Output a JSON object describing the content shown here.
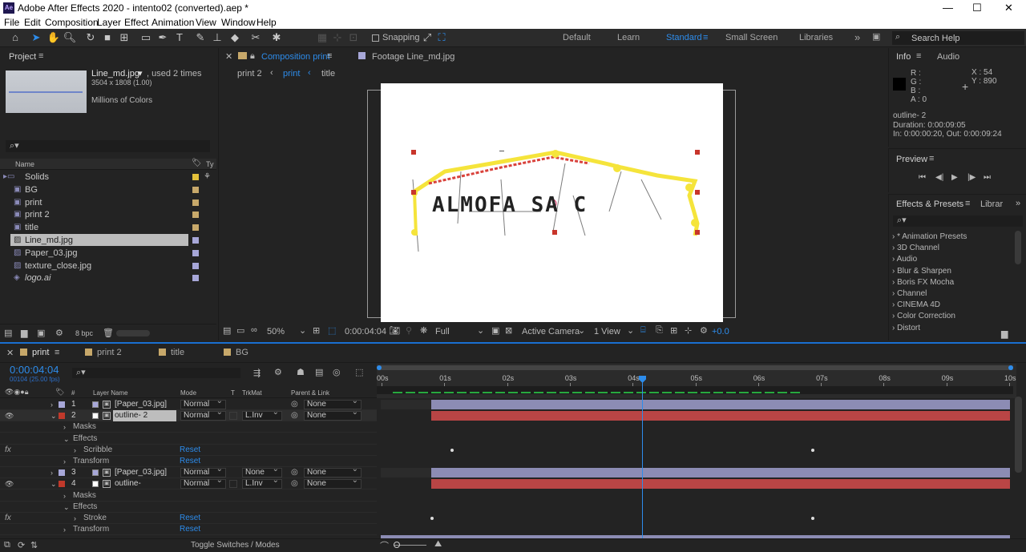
{
  "app": {
    "title": "Adobe After Effects 2020 - intento02 (converted).aep *",
    "icon": "Ae"
  },
  "window_controls": {
    "minimize": "—",
    "maximize": "☐",
    "close": "✕"
  },
  "menu": [
    "File",
    "Edit",
    "Composition",
    "Layer",
    "Effect",
    "Animation",
    "View",
    "Window",
    "Help"
  ],
  "toolbar": {
    "snapping": "Snapping"
  },
  "workspaces": {
    "items": [
      "Default",
      "Learn",
      "Standard",
      "Small Screen",
      "Libraries"
    ],
    "active": "Standard",
    "more": "»"
  },
  "search_help": "Search Help",
  "project": {
    "title": "Project",
    "item_name": "Line_md.jpg",
    "used": ", used 2 times",
    "dims": "3504 x 1808 (1.00)",
    "colors": "Millions of Colors",
    "col_name": "Name",
    "col_type": "Ty",
    "items": [
      {
        "name": "Solids",
        "color": "#e3c13a",
        "kind": "folder"
      },
      {
        "name": "BG",
        "color": "#c7a86a",
        "kind": "comp"
      },
      {
        "name": "print",
        "color": "#c7a86a",
        "kind": "comp"
      },
      {
        "name": "print 2",
        "color": "#c7a86a",
        "kind": "comp"
      },
      {
        "name": "title",
        "color": "#c7a86a",
        "kind": "comp"
      },
      {
        "name": "Line_md.jpg",
        "color": "#a7a7d8",
        "kind": "image",
        "selected": true
      },
      {
        "name": "Paper_03.jpg",
        "color": "#a7a7d8",
        "kind": "image"
      },
      {
        "name": "texture_close.jpg",
        "color": "#a7a7d8",
        "kind": "image"
      },
      {
        "name": "logo.ai",
        "color": "#a7a7d8",
        "kind": "ai"
      }
    ],
    "bpc": "8 bpc"
  },
  "comp_panel": {
    "tab_comp": "Composition print",
    "tab_footage": "Footage Line_md.jpg",
    "breadcrumbs": [
      "print 2",
      "print",
      "title"
    ],
    "active_crumb": "print",
    "canvas_text": "ALMOFA SA C"
  },
  "viewer_bar": {
    "zoom": "50%",
    "time": "0:00:04:04",
    "resolution": "Full",
    "camera": "Active Camera",
    "views": "1 View",
    "exposure": "+0.0"
  },
  "info": {
    "tab": "Info",
    "tab2": "Audio",
    "r": "R :",
    "g": "G :",
    "b": "B :",
    "a": "A : 0",
    "x": "X : 54",
    "y": "Y : 890",
    "layer": "outline- 2",
    "duration": "Duration: 0:00:09:05",
    "inout": "In: 0:00:00:20, Out: 0:00:09:24"
  },
  "preview": {
    "title": "Preview"
  },
  "effects": {
    "tab": "Effects & Presets",
    "tab2": "Librar",
    "items": [
      "* Animation Presets",
      "3D Channel",
      "Audio",
      "Blur & Sharpen",
      "Boris FX Mocha",
      "Channel",
      "CINEMA 4D",
      "Color Correction",
      "Distort"
    ]
  },
  "timeline": {
    "tabs": [
      {
        "label": "print",
        "color": "#c7a86a",
        "active": true
      },
      {
        "label": "print 2",
        "color": "#c7a86a"
      },
      {
        "label": "title",
        "color": "#c7a86a"
      },
      {
        "label": "BG",
        "color": "#c7a86a"
      }
    ],
    "timecode": "0:00:04:04",
    "fps": "00104 (25.00 fps)",
    "cols": {
      "name": "Layer Name",
      "mode": "Mode",
      "t": "T",
      "trkmat": "TrkMat",
      "parent": "Parent & Link",
      "num": "#"
    },
    "ruler": [
      "00s",
      "01s",
      "02s",
      "03s",
      "04s",
      "05s",
      "06s",
      "07s",
      "08s",
      "09s",
      "10s"
    ],
    "layers": [
      {
        "num": "1",
        "name": "[Paper_03.jpg]",
        "mode": "Normal",
        "trk": "",
        "parent": "None",
        "color": "#a7a7d8",
        "bar": "#8c8cb4"
      },
      {
        "num": "2",
        "name": "outline- 2",
        "mode": "Normal",
        "trk": "L.Inv",
        "parent": "None",
        "color": "#c0392b",
        "bar": "#b94545"
      },
      {
        "num": "3",
        "name": "[Paper_03.jpg]",
        "mode": "Normal",
        "trk": "None",
        "parent": "None",
        "color": "#a7a7d8",
        "bar": "#8c8cb4"
      },
      {
        "num": "4",
        "name": "outline-",
        "mode": "Normal",
        "trk": "L.Inv",
        "parent": "None",
        "color": "#c0392b",
        "bar": "#b94545"
      }
    ],
    "sub": {
      "masks": "Masks",
      "effects": "Effects",
      "scribble": "Scribble",
      "stroke": "Stroke",
      "transform": "Transform",
      "reset": "Reset",
      "fx": "fx"
    },
    "toggle": "Toggle Switches / Modes"
  }
}
